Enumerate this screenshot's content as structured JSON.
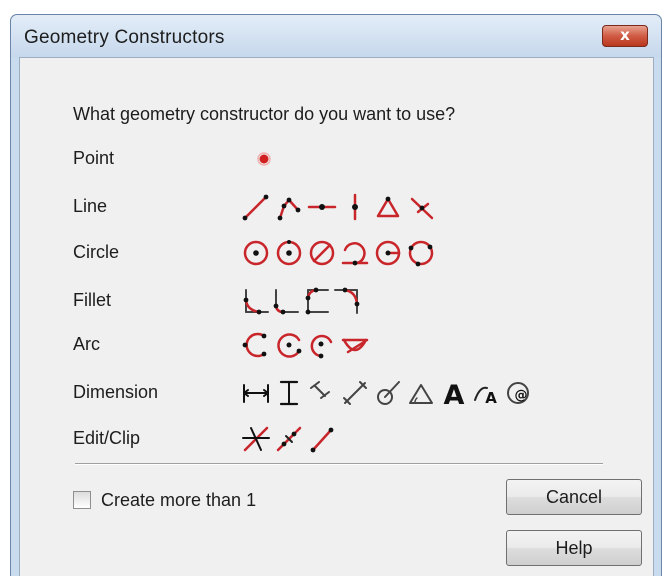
{
  "window": {
    "title": "Geometry Constructors",
    "close_label": "x"
  },
  "dialog": {
    "prompt": "What geometry constructor do you want to use?",
    "rows": [
      {
        "label": "Point",
        "icons": [
          "point-dot"
        ]
      },
      {
        "label": "Line",
        "icons": [
          "line-two-point",
          "line-polyline",
          "line-horizontal",
          "line-vertical",
          "line-angle",
          "line-perpendicular"
        ]
      },
      {
        "label": "Circle",
        "icons": [
          "circle-center-point",
          "circle-center-radius",
          "circle-diameter",
          "circle-tangent",
          "circle-two-point",
          "circle-three-point"
        ]
      },
      {
        "label": "Fillet",
        "icons": [
          "fillet-simple",
          "fillet-trim",
          "fillet-chain",
          "fillet-corner"
        ]
      },
      {
        "label": "Arc",
        "icons": [
          "arc-three-point",
          "arc-center",
          "arc-tangent",
          "arc-chord"
        ]
      },
      {
        "label": "Dimension",
        "icons": [
          "dimension-horizontal",
          "dimension-vertical",
          "dimension-parallel",
          "dimension-diagonal",
          "dimension-radial",
          "dimension-angular",
          "dimension-text",
          "dimension-arc-text",
          "dimension-circle-text"
        ]
      },
      {
        "label": "Edit/Clip",
        "icons": [
          "edit-trim",
          "edit-split",
          "edit-extend"
        ]
      }
    ],
    "checkbox_label": "Create more than 1",
    "checkbox_checked": false,
    "cancel_label": "Cancel",
    "help_label": "Help"
  },
  "colors": {
    "accent_red": "#c8262b",
    "title_gradient_top": "#e3edf8",
    "dialog_bg": "#f0f0f0"
  }
}
